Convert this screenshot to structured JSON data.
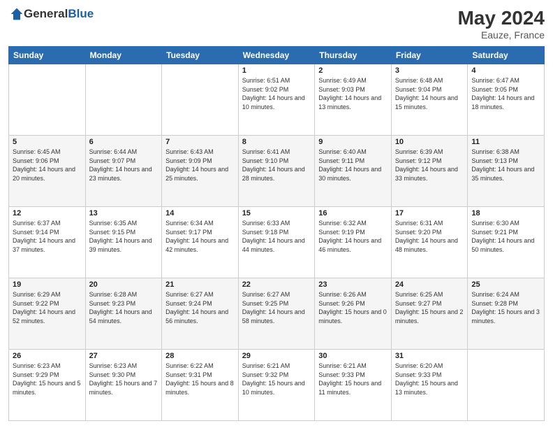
{
  "header": {
    "logo": {
      "general": "General",
      "blue": "Blue"
    },
    "title": "May 2024",
    "location": "Eauze, France"
  },
  "weekdays": [
    "Sunday",
    "Monday",
    "Tuesday",
    "Wednesday",
    "Thursday",
    "Friday",
    "Saturday"
  ],
  "weeks": [
    [
      null,
      null,
      null,
      {
        "day": 1,
        "sunrise": "Sunrise: 6:51 AM",
        "sunset": "Sunset: 9:02 PM",
        "daylight": "Daylight: 14 hours and 10 minutes."
      },
      {
        "day": 2,
        "sunrise": "Sunrise: 6:49 AM",
        "sunset": "Sunset: 9:03 PM",
        "daylight": "Daylight: 14 hours and 13 minutes."
      },
      {
        "day": 3,
        "sunrise": "Sunrise: 6:48 AM",
        "sunset": "Sunset: 9:04 PM",
        "daylight": "Daylight: 14 hours and 15 minutes."
      },
      {
        "day": 4,
        "sunrise": "Sunrise: 6:47 AM",
        "sunset": "Sunset: 9:05 PM",
        "daylight": "Daylight: 14 hours and 18 minutes."
      }
    ],
    [
      {
        "day": 5,
        "sunrise": "Sunrise: 6:45 AM",
        "sunset": "Sunset: 9:06 PM",
        "daylight": "Daylight: 14 hours and 20 minutes."
      },
      {
        "day": 6,
        "sunrise": "Sunrise: 6:44 AM",
        "sunset": "Sunset: 9:07 PM",
        "daylight": "Daylight: 14 hours and 23 minutes."
      },
      {
        "day": 7,
        "sunrise": "Sunrise: 6:43 AM",
        "sunset": "Sunset: 9:09 PM",
        "daylight": "Daylight: 14 hours and 25 minutes."
      },
      {
        "day": 8,
        "sunrise": "Sunrise: 6:41 AM",
        "sunset": "Sunset: 9:10 PM",
        "daylight": "Daylight: 14 hours and 28 minutes."
      },
      {
        "day": 9,
        "sunrise": "Sunrise: 6:40 AM",
        "sunset": "Sunset: 9:11 PM",
        "daylight": "Daylight: 14 hours and 30 minutes."
      },
      {
        "day": 10,
        "sunrise": "Sunrise: 6:39 AM",
        "sunset": "Sunset: 9:12 PM",
        "daylight": "Daylight: 14 hours and 33 minutes."
      },
      {
        "day": 11,
        "sunrise": "Sunrise: 6:38 AM",
        "sunset": "Sunset: 9:13 PM",
        "daylight": "Daylight: 14 hours and 35 minutes."
      }
    ],
    [
      {
        "day": 12,
        "sunrise": "Sunrise: 6:37 AM",
        "sunset": "Sunset: 9:14 PM",
        "daylight": "Daylight: 14 hours and 37 minutes."
      },
      {
        "day": 13,
        "sunrise": "Sunrise: 6:35 AM",
        "sunset": "Sunset: 9:15 PM",
        "daylight": "Daylight: 14 hours and 39 minutes."
      },
      {
        "day": 14,
        "sunrise": "Sunrise: 6:34 AM",
        "sunset": "Sunset: 9:17 PM",
        "daylight": "Daylight: 14 hours and 42 minutes."
      },
      {
        "day": 15,
        "sunrise": "Sunrise: 6:33 AM",
        "sunset": "Sunset: 9:18 PM",
        "daylight": "Daylight: 14 hours and 44 minutes."
      },
      {
        "day": 16,
        "sunrise": "Sunrise: 6:32 AM",
        "sunset": "Sunset: 9:19 PM",
        "daylight": "Daylight: 14 hours and 46 minutes."
      },
      {
        "day": 17,
        "sunrise": "Sunrise: 6:31 AM",
        "sunset": "Sunset: 9:20 PM",
        "daylight": "Daylight: 14 hours and 48 minutes."
      },
      {
        "day": 18,
        "sunrise": "Sunrise: 6:30 AM",
        "sunset": "Sunset: 9:21 PM",
        "daylight": "Daylight: 14 hours and 50 minutes."
      }
    ],
    [
      {
        "day": 19,
        "sunrise": "Sunrise: 6:29 AM",
        "sunset": "Sunset: 9:22 PM",
        "daylight": "Daylight: 14 hours and 52 minutes."
      },
      {
        "day": 20,
        "sunrise": "Sunrise: 6:28 AM",
        "sunset": "Sunset: 9:23 PM",
        "daylight": "Daylight: 14 hours and 54 minutes."
      },
      {
        "day": 21,
        "sunrise": "Sunrise: 6:27 AM",
        "sunset": "Sunset: 9:24 PM",
        "daylight": "Daylight: 14 hours and 56 minutes."
      },
      {
        "day": 22,
        "sunrise": "Sunrise: 6:27 AM",
        "sunset": "Sunset: 9:25 PM",
        "daylight": "Daylight: 14 hours and 58 minutes."
      },
      {
        "day": 23,
        "sunrise": "Sunrise: 6:26 AM",
        "sunset": "Sunset: 9:26 PM",
        "daylight": "Daylight: 15 hours and 0 minutes."
      },
      {
        "day": 24,
        "sunrise": "Sunrise: 6:25 AM",
        "sunset": "Sunset: 9:27 PM",
        "daylight": "Daylight: 15 hours and 2 minutes."
      },
      {
        "day": 25,
        "sunrise": "Sunrise: 6:24 AM",
        "sunset": "Sunset: 9:28 PM",
        "daylight": "Daylight: 15 hours and 3 minutes."
      }
    ],
    [
      {
        "day": 26,
        "sunrise": "Sunrise: 6:23 AM",
        "sunset": "Sunset: 9:29 PM",
        "daylight": "Daylight: 15 hours and 5 minutes."
      },
      {
        "day": 27,
        "sunrise": "Sunrise: 6:23 AM",
        "sunset": "Sunset: 9:30 PM",
        "daylight": "Daylight: 15 hours and 7 minutes."
      },
      {
        "day": 28,
        "sunrise": "Sunrise: 6:22 AM",
        "sunset": "Sunset: 9:31 PM",
        "daylight": "Daylight: 15 hours and 8 minutes."
      },
      {
        "day": 29,
        "sunrise": "Sunrise: 6:21 AM",
        "sunset": "Sunset: 9:32 PM",
        "daylight": "Daylight: 15 hours and 10 minutes."
      },
      {
        "day": 30,
        "sunrise": "Sunrise: 6:21 AM",
        "sunset": "Sunset: 9:33 PM",
        "daylight": "Daylight: 15 hours and 11 minutes."
      },
      {
        "day": 31,
        "sunrise": "Sunrise: 6:20 AM",
        "sunset": "Sunset: 9:33 PM",
        "daylight": "Daylight: 15 hours and 13 minutes."
      },
      null
    ]
  ]
}
